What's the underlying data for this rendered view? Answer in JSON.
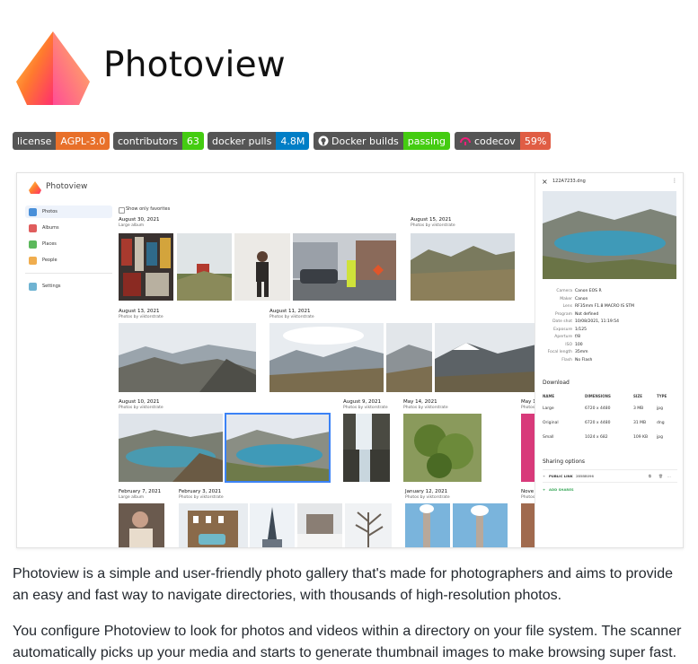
{
  "header": {
    "title": "Photoview"
  },
  "badges": [
    {
      "label": "license",
      "value": "AGPL-3.0",
      "color": "#e8702a"
    },
    {
      "label": "contributors",
      "value": "63",
      "color": "#4c1"
    },
    {
      "label": "docker pulls",
      "value": "4.8M",
      "color": "#007ec6"
    },
    {
      "label": "Docker builds",
      "value": "passing",
      "color": "#4c1",
      "icon": "github-icon"
    },
    {
      "label": "codecov",
      "value": "59%",
      "color": "#e05d44",
      "icon": "codecov-icon"
    }
  ],
  "app": {
    "title": "Photoview",
    "sidebar": [
      {
        "label": "Photos",
        "icon": "photos-icon",
        "color": "#4a90d9"
      },
      {
        "label": "Albums",
        "icon": "albums-icon",
        "color": "#e05d5d"
      },
      {
        "label": "Places",
        "icon": "places-icon",
        "color": "#5cb85c"
      },
      {
        "label": "People",
        "icon": "people-icon",
        "color": "#f0ad4e"
      },
      {
        "label": "Settings",
        "icon": "settings-icon",
        "color": "#6fb3d2"
      }
    ],
    "favorites_label": "Show only favorites",
    "groups": [
      {
        "date": "August 30, 2021",
        "sub": "Large album"
      },
      {
        "date": "August 15, 2021",
        "sub": "Photos by viktorstrate"
      },
      {
        "date": "August 13, 2021",
        "sub": "Photos by viktorstrate"
      },
      {
        "date": "August 11, 2021",
        "sub": "Photos by viktorstrate"
      },
      {
        "date": "August 10, 2021",
        "sub": "Photos by viktorstrate"
      },
      {
        "date": "August 9, 2021",
        "sub": "Photos by viktorstrate"
      },
      {
        "date": "May 14, 2021",
        "sub": "Photos by viktorstrate"
      },
      {
        "date": "May 1",
        "sub": "Photos"
      },
      {
        "date": "February 7, 2021",
        "sub": "Large album"
      },
      {
        "date": "February 3, 2021",
        "sub": "Photos by viktorstrate"
      },
      {
        "date": "January 12, 2021",
        "sub": "Photos by viktorstrate"
      },
      {
        "date": "Nove",
        "sub": "Photos"
      }
    ],
    "panel": {
      "filename": "122A7233.dng",
      "close": "×",
      "more": "⋮",
      "exif": [
        {
          "k": "Camera",
          "v": "Canon EOS R"
        },
        {
          "k": "Maker",
          "v": "Canon"
        },
        {
          "k": "Lens",
          "v": "RF35mm F1.8 MACRO IS STM"
        },
        {
          "k": "Program",
          "v": "Not defined"
        },
        {
          "k": "Date shot",
          "v": "10/08/2021, 11:19:54"
        },
        {
          "k": "Exposure",
          "v": "1/125"
        },
        {
          "k": "Aperture",
          "v": "f/8"
        },
        {
          "k": "ISO",
          "v": "100"
        },
        {
          "k": "Focal length",
          "v": "35mm"
        },
        {
          "k": "Flash",
          "v": "No Flash"
        }
      ],
      "download_title": "Download",
      "download_headers": [
        "NAME",
        "DIMENSIONS",
        "SIZE",
        "TYPE"
      ],
      "downloads": [
        [
          "Large",
          "6720 x 4480",
          "3 MB",
          "jpg"
        ],
        [
          "Original",
          "6720 x 4480",
          "31 MB",
          "dng"
        ],
        [
          "Small",
          "1024 x 682",
          "109 KB",
          "jpg"
        ]
      ],
      "sharing_title": "Sharing options",
      "public_link": "PUBLIC LINK",
      "public_link_id": "2B5BB096",
      "add_shares": "ADD SHARES"
    }
  },
  "paragraphs": [
    "Photoview is a simple and user-friendly photo gallery that's made for photographers and aims to provide an easy and fast way to navigate directories, with thousands of high-resolution photos.",
    "You configure Photoview to look for photos and videos within a directory on your file system. The scanner automatically picks up your media and starts to generate thumbnail images to make browsing super fast."
  ]
}
